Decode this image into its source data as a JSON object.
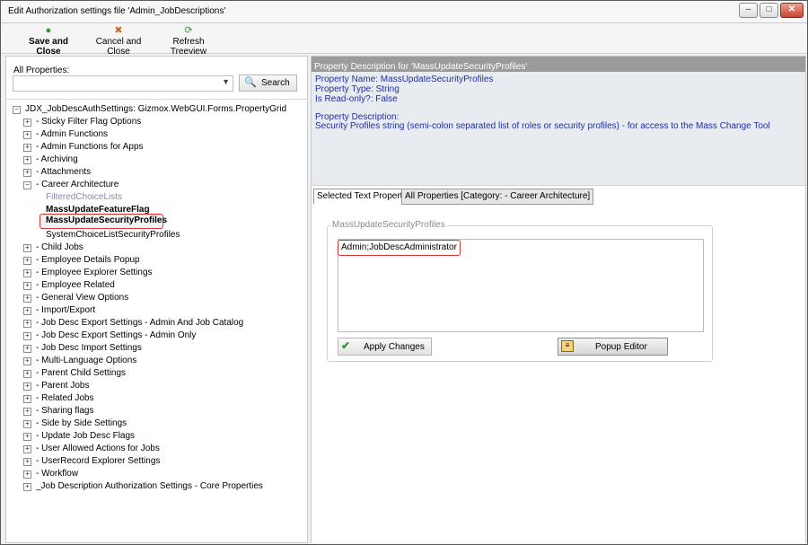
{
  "window": {
    "title": "Edit Authorization settings file 'Admin_JobDescriptions'",
    "controls": [
      "minimize",
      "maximize",
      "close"
    ]
  },
  "toolbar": {
    "save_label": "Save and Close",
    "cancel_label": "Cancel and Close",
    "refresh_label": "Refresh Treeview"
  },
  "left": {
    "all_properties_label": "All Properties:",
    "select_value": "",
    "search_label": "Search",
    "tree_root": "JDX_JobDescAuthSettings: Gizmox.WebGUI.Forms.PropertyGrid",
    "groups_before": [
      "- Sticky Filter Flag Options",
      "- Admin Functions",
      "- Admin Functions for Apps",
      "- Archiving",
      "- Attachments"
    ],
    "expanded_group": "- Career Architecture",
    "expanded_children": [
      {
        "label": "FilteredChoiceLists",
        "style": "muted"
      },
      {
        "label": "MassUpdateFeatureFlag",
        "style": "bold"
      },
      {
        "label": "MassUpdateSecurityProfiles",
        "style": "selected"
      },
      {
        "label": "SystemChoiceListSecurityProfiles",
        "style": "normal"
      }
    ],
    "groups_after": [
      "- Child Jobs",
      "- Employee Details Popup",
      "- Employee Explorer Settings",
      "- Employee Related",
      "- General View Options",
      "- Import/Export",
      "- Job Desc Export Settings - Admin And Job Catalog",
      "- Job Desc Export Settings - Admin Only",
      "- Job Desc Import Settings",
      "- Multi-Language Options",
      "- Parent Child Settings",
      "- Parent Jobs",
      "- Related Jobs",
      "- Sharing flags",
      "- Side by Side Settings",
      "- Update Job Desc Flags",
      "- User Allowed Actions for Jobs",
      "- UserRecord Explorer Settings",
      "- Workflow",
      "_Job Description Authorization Settings - Core Properties"
    ]
  },
  "right": {
    "desc_header": "Property Description for 'MassUpdateSecurityProfiles'",
    "property_name": "Property Name: MassUpdateSecurityProfiles",
    "property_type": "Property Type: String",
    "read_only": "Is Read-only?: False",
    "desc_label": "Property Description:",
    "desc_text": "Security Profiles string (semi-colon separated list of roles or security profiles) - for access to the Mass Change Tool",
    "tabs": [
      "Selected Text Property",
      "All Properties [Category: - Career Architecture]"
    ],
    "group_title": "MassUpdateSecurityProfiles",
    "value": "Admin;JobDescAdministrator",
    "apply_label": "Apply Changes",
    "popup_label": "Popup Editor"
  },
  "colors": {
    "highlight_border": "#d9312f",
    "desc_text": "#1f2fa0",
    "desc_header_bg": "#9b9b9b"
  }
}
